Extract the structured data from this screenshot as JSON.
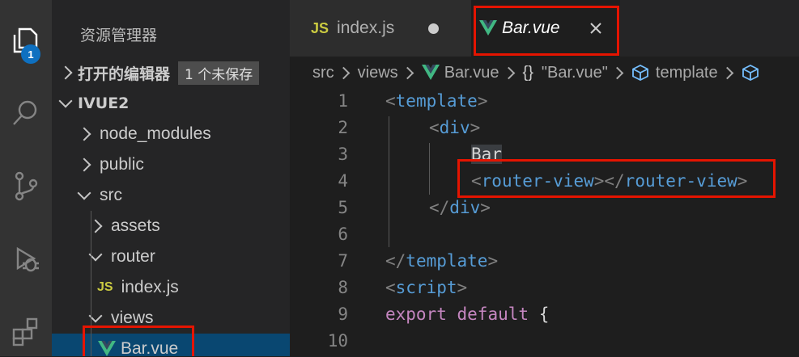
{
  "activity_bar": {
    "icons": [
      "explorer-icon",
      "search-icon",
      "source-control-icon",
      "run-debug-icon",
      "extensions-icon"
    ],
    "badge": "1"
  },
  "sidebar": {
    "title": "资源管理器",
    "open_editors": {
      "label": "打开的编辑器",
      "unsaved_badge": "1 个未保存"
    },
    "project": "IVUE2",
    "tree": [
      {
        "label": "node_modules"
      },
      {
        "label": "public"
      },
      {
        "label": "src"
      },
      {
        "label": "assets"
      },
      {
        "label": "router"
      },
      {
        "label": "index.js",
        "icon": "JS"
      },
      {
        "label": "views"
      },
      {
        "label": "Bar.vue"
      }
    ]
  },
  "tabs": [
    {
      "icon": "JS",
      "label": "index.js"
    },
    {
      "label": "Bar.vue"
    }
  ],
  "breadcrumb": {
    "src": "src",
    "views": "views",
    "file": "Bar.vue",
    "braces": "{}",
    "component": "\"Bar.vue\"",
    "template": "template"
  },
  "editor": {
    "line_numbers": [
      "1",
      "2",
      "3",
      "4",
      "5",
      "6",
      "7",
      "8",
      "9",
      "10"
    ],
    "code": {
      "l1_tag": "template",
      "l2_tag": "div",
      "l3_text": "Bar",
      "l4_open": "router-view",
      "l4_close": "router-view",
      "l5_tag": "div",
      "l7_tag": "template",
      "l8_tag": "script",
      "l9_kw1": "export",
      "l9_kw2": "default",
      "l9_brace": "{"
    }
  },
  "colors": {
    "accent_badge": "#0e70c0",
    "highlight_box": "#e51400",
    "vue_green": "#41b883",
    "js_yellow": "#cbcb41"
  }
}
